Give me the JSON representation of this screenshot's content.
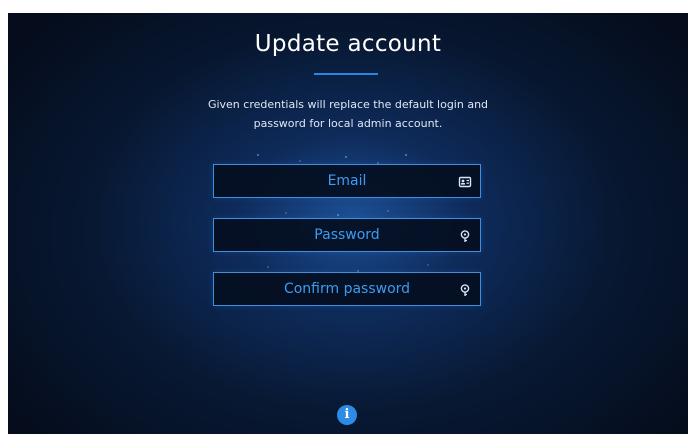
{
  "title": "Update account",
  "description": "Given credentials will replace the default login and password for local admin account.",
  "fields": {
    "email": {
      "placeholder": "Email",
      "value": "",
      "icon": "id-card-icon"
    },
    "password": {
      "placeholder": "Password",
      "value": "",
      "icon": "key-icon"
    },
    "confirm_password": {
      "placeholder": "Confirm password",
      "value": "",
      "icon": "key-icon"
    }
  },
  "footer": {
    "info_icon": "info-icon",
    "info_glyph": "i"
  },
  "colors": {
    "accent": "#2a86e0",
    "field_border": "#3f8ee0",
    "placeholder": "#3d9bf2",
    "background_dark": "#050d1d",
    "background_glow": "#1d5fae"
  }
}
